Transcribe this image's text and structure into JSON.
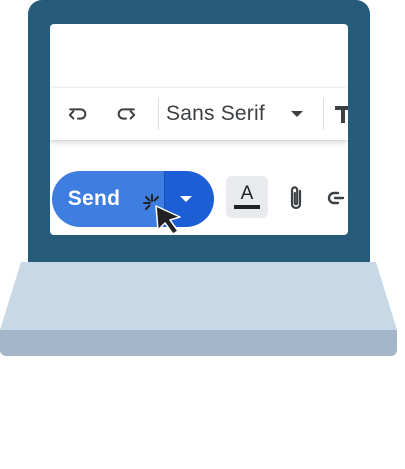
{
  "toolbar": {
    "undo_icon": "undo-icon",
    "redo_icon": "redo-icon",
    "font_family": "Sans Serif",
    "text_size_icon": "text-size-icon"
  },
  "compose_actions": {
    "send_label": "Send",
    "send_options_icon": "chevron-down-icon",
    "formatting_label": "A",
    "attach_icon": "paperclip-icon",
    "link_icon": "link-icon"
  },
  "colors": {
    "laptop_lid": "#275b7a",
    "send_primary": "#3f7ee1",
    "send_secondary": "#1c5ed6",
    "base_top": "#c8d8e6",
    "base_front": "#a4b6c9"
  }
}
